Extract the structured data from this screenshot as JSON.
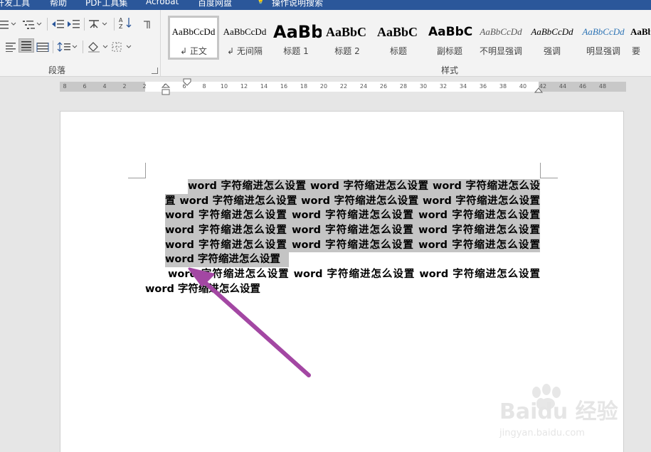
{
  "topbar": {
    "items": [
      "开发工具",
      "帮助",
      "PDF工具集",
      "Acrobat",
      "百度网盘",
      "操作说明搜索"
    ]
  },
  "ribbon": {
    "paragraph_group_label": "段落",
    "styles_group_label": "样式",
    "styles": [
      {
        "preview": "AaBbCcDd",
        "name": "正文",
        "selected": true
      },
      {
        "preview": "AaBbCcDd",
        "name": "无间隔",
        "selected": false
      },
      {
        "preview": "AaBb",
        "name": "标题 1",
        "selected": false
      },
      {
        "preview": "AaBbC",
        "name": "标题 2",
        "selected": false
      },
      {
        "preview": "AaBbC",
        "name": "标题",
        "selected": false
      },
      {
        "preview": "AaBbC",
        "name": "副标题",
        "selected": false
      },
      {
        "preview": "AaBbCcDd",
        "name": "不明显强调",
        "selected": false
      },
      {
        "preview": "AaBbCcDd",
        "name": "强调",
        "selected": false
      },
      {
        "preview": "AaBbCcDd",
        "name": "明显强调",
        "selected": false
      },
      {
        "preview": "AaBb",
        "name": "要",
        "selected": false
      }
    ]
  },
  "ruler": {
    "ticks": [
      "8",
      "6",
      "4",
      "2",
      "2",
      "4",
      "6",
      "8",
      "10",
      "12",
      "14",
      "16",
      "18",
      "20",
      "22",
      "24",
      "26",
      "28",
      "30",
      "32",
      "34",
      "36",
      "38",
      "40",
      "42",
      "44",
      "46",
      "48"
    ]
  },
  "document": {
    "paragraph1_lines": [
      "word 字符缩进怎么设置 word 字符缩进怎么设置 word 字符缩进怎么设",
      "置 word 字符缩进怎么设置 word 字符缩进怎么设置 word 字符缩进怎么设置",
      "word 字符缩进怎么设置 word 字符缩进怎么设置 word 字符缩进怎么设置",
      "word 字符缩进怎么设置 word 字符缩进怎么设置 word 字符缩进怎么设置",
      "word 字符缩进怎么设置 word 字符缩进怎么设置 word 字符缩进怎么设置",
      "word 字符缩进怎么设置"
    ],
    "paragraph2_lines": [
      "word 字符缩进怎么设置 word 字符缩进怎么设置 word 字符缩进怎么设置",
      "word 字符缩进怎么设置"
    ]
  },
  "watermark": {
    "brand": "Baidu 经验",
    "url": "jingyan.baidu.com"
  },
  "colors": {
    "title_bar": "#2b579a",
    "selection": "#c4c4c4",
    "arrow": "#a347a3"
  }
}
